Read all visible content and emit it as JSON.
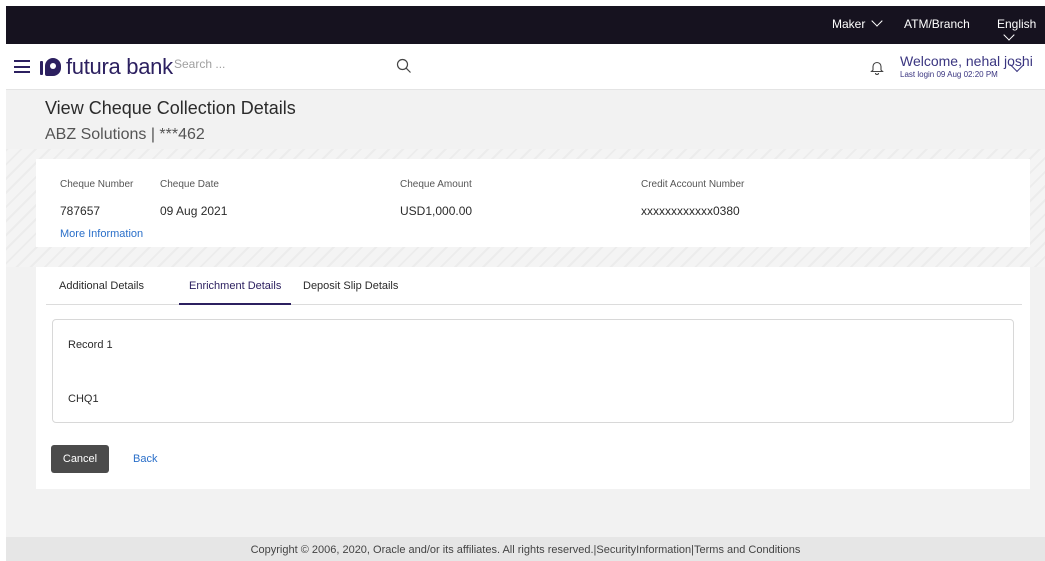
{
  "topbar": {
    "role": "Maker",
    "location": "ATM/Branch",
    "language": "English"
  },
  "header": {
    "brand": "futura bank",
    "search_placeholder": "Search ...",
    "welcome": "Welcome, nehal joshi",
    "last_login": "Last login 09 Aug 02:20 PM"
  },
  "page": {
    "title": "View Cheque Collection Details",
    "subtitle": "ABZ Solutions | ***462"
  },
  "cheque": {
    "number_label": "Cheque Number",
    "number": "787657",
    "date_label": "Cheque Date",
    "date": "09 Aug 2021",
    "amount_label": "Cheque Amount",
    "amount": "USD1,000.00",
    "account_label": "Credit Account Number",
    "account": "xxxxxxxxxxxx0380",
    "more_info": "More Information"
  },
  "tabs": [
    {
      "label": "Additional Details",
      "active": false
    },
    {
      "label": "Enrichment Details",
      "active": true
    },
    {
      "label": "Deposit Slip Details",
      "active": false
    }
  ],
  "record": {
    "title": "Record 1",
    "value": "CHQ1"
  },
  "actions": {
    "cancel": "Cancel",
    "back": "Back"
  },
  "footer": {
    "text": "Copyright © 2006, 2020, Oracle and/or its affiliates. All rights reserved.|SecurityInformation|Terms and Conditions"
  },
  "colors": {
    "brand": "#2c2060",
    "topbar": "#16121f",
    "link": "#2a6fc9"
  }
}
